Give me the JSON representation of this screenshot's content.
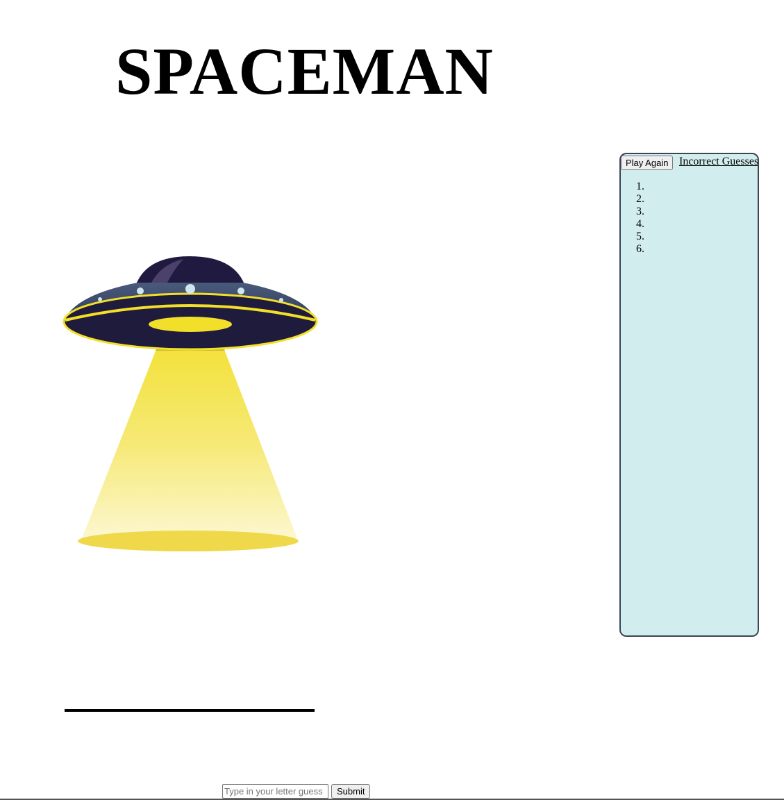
{
  "game": {
    "title": "SPACEMAN"
  },
  "ufo": {
    "icon": "ufo-icon",
    "colors": {
      "dome": "#211a40",
      "rim": "#3c4b6d",
      "saucer": "#1f1b3d",
      "beam": "#f5e25a",
      "accent": "#f2df2a",
      "lights": "#cfe6ee"
    }
  },
  "sidebar": {
    "play_again_label": "Play Again",
    "incorrect_title": "Incorrect Guesses",
    "incorrect_guesses": [
      "",
      "",
      "",
      "",
      "",
      ""
    ],
    "background": "#d2edee",
    "border": "#3b4556"
  },
  "word": {
    "display": ""
  },
  "guess_form": {
    "placeholder": "Type in your letter guess",
    "value": "",
    "submit_label": "Submit"
  }
}
